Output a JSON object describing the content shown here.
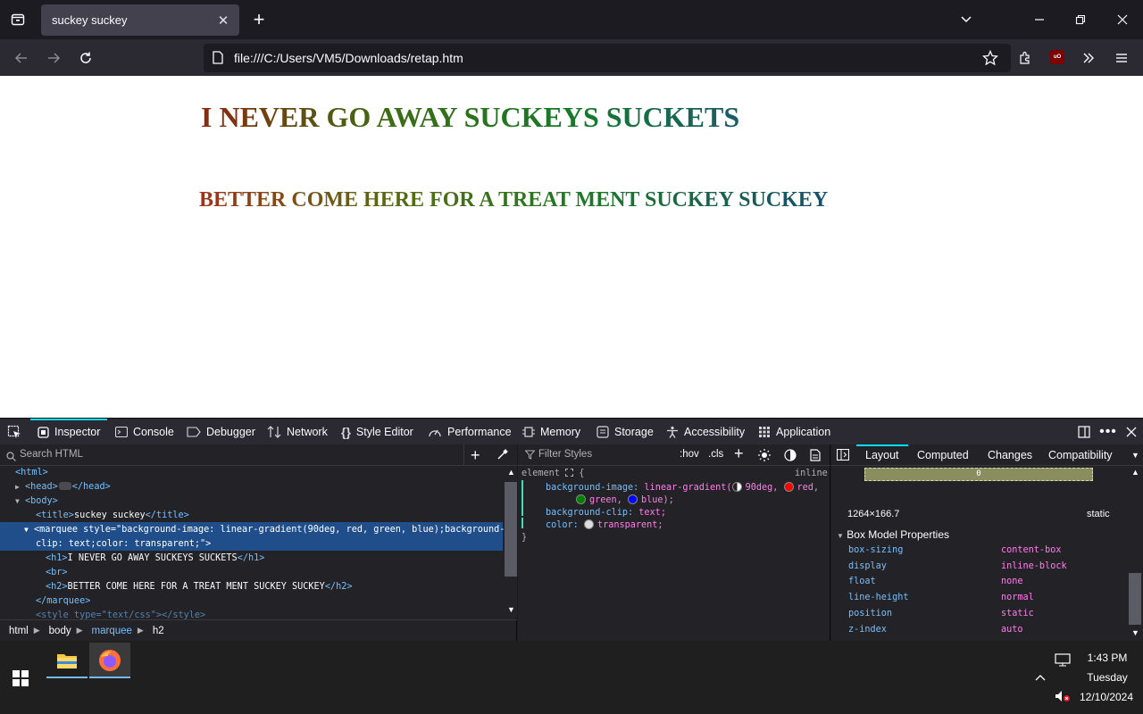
{
  "browser": {
    "tab_title": "suckey suckey",
    "url": "file:///C:/Users/VM5/Downloads/retap.htm"
  },
  "page": {
    "h1": "I NEVER GO AWAY SUCKEYS SUCKETS",
    "h2": "BETTER COME HERE FOR A TREAT MENT SUCKEY SUCKEY"
  },
  "devtools": {
    "tabs": [
      "Inspector",
      "Console",
      "Debugger",
      "Network",
      "Style Editor",
      "Performance",
      "Memory",
      "Storage",
      "Accessibility",
      "Application"
    ],
    "search_placeholder": "Search HTML",
    "markup": {
      "html_open": "<html>",
      "head_open": "<head>",
      "head_close": "</head>",
      "body_open": "<body>",
      "title_open": "<title>",
      "title_text": "suckey suckey",
      "title_close": "</title>",
      "marquee_line1": "<marquee style=\"background-image: linear-gradient(90deg, red, green, blue);background-",
      "marquee_line2": "clip: text;color: transparent;\">",
      "h1_open": "<h1>",
      "h1_text": "I NEVER GO AWAY SUCKEYS SUCKETS",
      "h1_close": "</h1>",
      "br": "<br>",
      "h2_open": "<h2>",
      "h2_text": "BETTER COME HERE FOR A TREAT MENT SUCKEY SUCKEY",
      "h2_close": "</h2>",
      "marquee_close": "</marquee>",
      "style_line": "<style type=\"text/css\"></style>"
    },
    "breadcrumbs": [
      "html",
      "body",
      "marquee",
      "h2"
    ],
    "rules": {
      "filter_placeholder": "Filter Styles",
      "hov": ":hov",
      "cls": ".cls",
      "selector": "element",
      "brace_open": "{",
      "brace_close": "}",
      "source": "inline",
      "bg_image_prop": "background-image:",
      "bg_image_fn": "linear-gradient(",
      "deg": "90deg,",
      "red": "red,",
      "green": "green,",
      "blue": "blue);",
      "bg_clip_prop": "background-clip:",
      "bg_clip_val": "text;",
      "color_prop": "color:",
      "color_val": "transparent;"
    },
    "layout_tabs": [
      "Layout",
      "Computed",
      "Changes",
      "Compatibility"
    ],
    "layout": {
      "box_value": "0",
      "dimensions": "1264×166.7",
      "position": "static",
      "box_model_header": "Box Model Properties",
      "properties": [
        {
          "name": "box-sizing",
          "value": "content-box"
        },
        {
          "name": "display",
          "value": "inline-block"
        },
        {
          "name": "float",
          "value": "none"
        },
        {
          "name": "line-height",
          "value": "normal"
        },
        {
          "name": "position",
          "value": "static"
        },
        {
          "name": "z-index",
          "value": "auto"
        }
      ]
    }
  },
  "taskbar": {
    "time": "1:43 PM",
    "day": "Tuesday",
    "date": "12/10/2024"
  },
  "colors": {
    "accent": "#00ddff",
    "selection": "#204e8a",
    "tag": "#75bfff",
    "attr": "#ff7de9"
  }
}
